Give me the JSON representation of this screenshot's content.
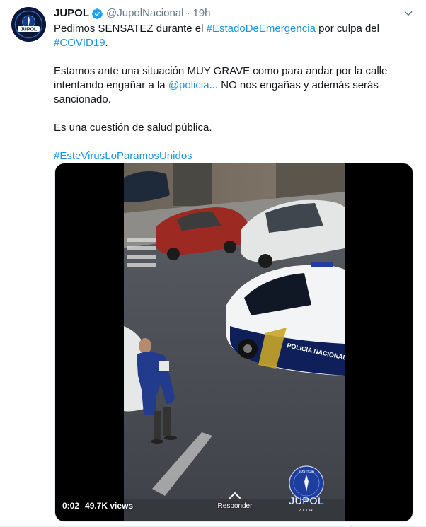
{
  "author": {
    "name": "JUPOL",
    "handle": "@JupolNacional",
    "separator": "·",
    "time": "19h",
    "avatar_icon": "jupol-logo-icon",
    "verified_icon": "verified-badge-icon",
    "verified_color": "#1da1f2"
  },
  "tweet": {
    "p1_a": "Pedimos SENSATEZ durante el ",
    "p1_link1": "#EstadoDeEmergencia",
    "p1_b": " por culpa del ",
    "p1_link2": "#COVID19",
    "p1_c": ".",
    "p2_a": "Estamos ante una situación MUY GRAVE como para andar por la calle intentando engañar a la ",
    "p2_link": "@policia",
    "p2_b": "... NO nos engañas y además serás sancionado.",
    "p3": "Es una cuestión de salud pública.",
    "p4_link": "#EsteVirusLoParamosUnidos",
    "link_color": "#1b95e0"
  },
  "video": {
    "elapsed": "0:02",
    "views": "49.7K views",
    "reply_label": "Responder",
    "watermark_top": "JUSTICIA",
    "watermark_main": "JUPOL",
    "watermark_bottom": "POLICIAL",
    "van_text": "POLICIA NACIONAL"
  }
}
